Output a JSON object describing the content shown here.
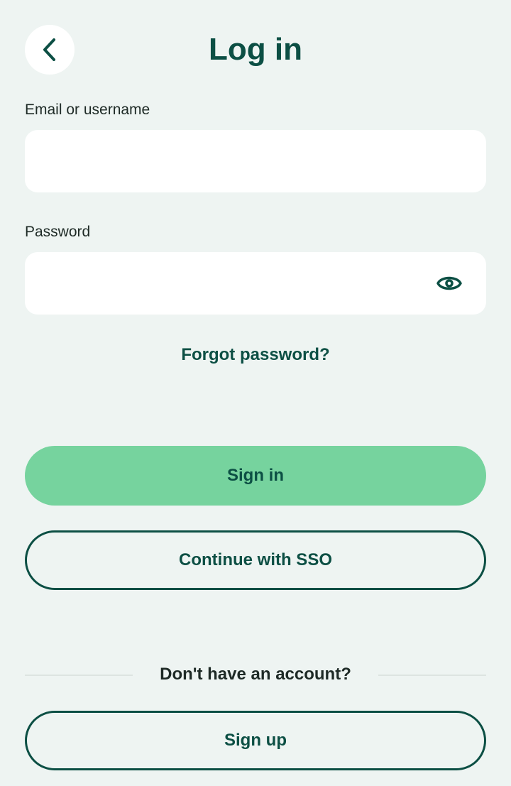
{
  "header": {
    "title": "Log in"
  },
  "form": {
    "email_label": "Email or username",
    "email_value": "",
    "password_label": "Password",
    "password_value": "",
    "forgot_password": "Forgot password?"
  },
  "actions": {
    "sign_in": "Sign in",
    "sso": "Continue with SSO"
  },
  "footer": {
    "no_account": "Don't have an account?",
    "sign_up": "Sign up"
  },
  "colors": {
    "background": "#eef4f2",
    "brand_dark": "#0c4f44",
    "primary_button": "#76d39e",
    "field_background": "#ffffff"
  },
  "icons": {
    "back": "chevron-left-icon",
    "password_visibility": "eye-icon"
  }
}
